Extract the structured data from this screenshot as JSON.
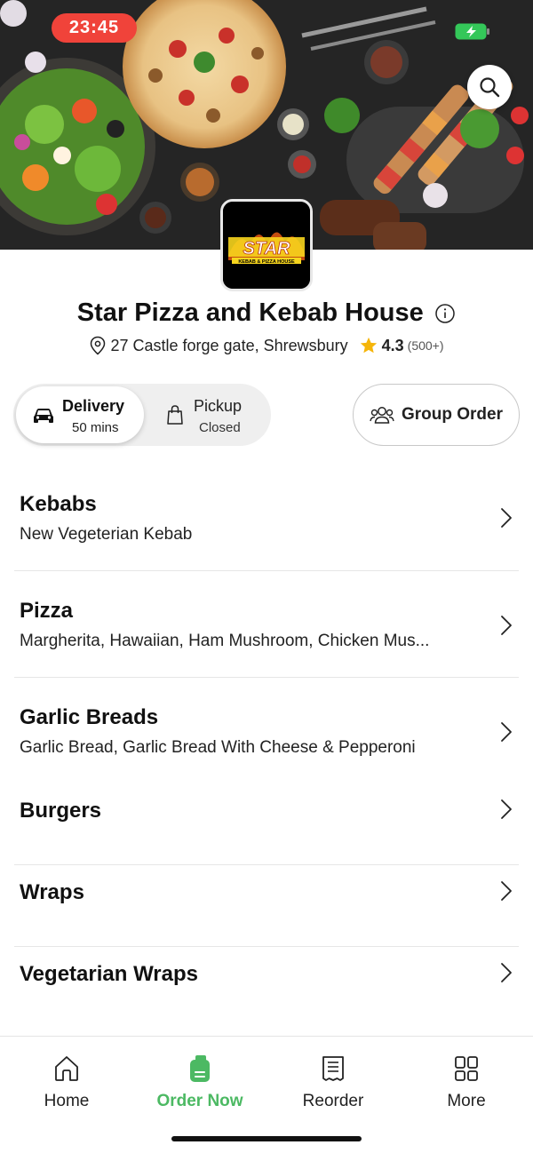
{
  "status_bar": {
    "time": "23:45",
    "battery_icon": "battery-charging-icon"
  },
  "header": {
    "search_icon": "search-icon"
  },
  "restaurant": {
    "logo_text": "STAR",
    "logo_subtext": "KEBAB & PIZZA HOUSE",
    "name": "Star Pizza and Kebab House",
    "address": "27 Castle forge gate, Shrewsbury",
    "rating": "4.3",
    "rating_count": "(500+)"
  },
  "order_mode": {
    "delivery": {
      "label": "Delivery",
      "sub": "50 mins",
      "selected": true
    },
    "pickup": {
      "label": "Pickup",
      "sub": "Closed",
      "selected": false
    },
    "group_order": {
      "label": "Group Order"
    }
  },
  "categories": [
    {
      "name": "Kebabs",
      "description": "New Vegeterian Kebab"
    },
    {
      "name": "Pizza",
      "description": "Margherita, Hawaiian, Ham Mushroom, Chicken Mus..."
    },
    {
      "name": "Garlic Breads",
      "description": "Garlic Bread, Garlic Bread With Cheese & Pepperoni"
    },
    {
      "name": "Burgers",
      "description": ""
    },
    {
      "name": "Wraps",
      "description": ""
    },
    {
      "name": "Vegetarian Wraps",
      "description": ""
    }
  ],
  "bottom_nav": [
    {
      "label": "Home",
      "icon": "home-icon",
      "active": false
    },
    {
      "label": "Order Now",
      "icon": "order-icon",
      "active": true
    },
    {
      "label": "Reorder",
      "icon": "receipt-icon",
      "active": false
    },
    {
      "label": "More",
      "icon": "grid-icon",
      "active": false
    }
  ],
  "colors": {
    "accent_green": "#4cb963",
    "status_red": "#f0433a",
    "star_gold": "#f5b50a"
  }
}
